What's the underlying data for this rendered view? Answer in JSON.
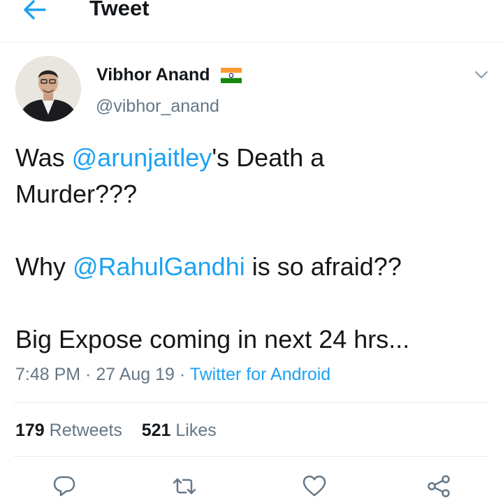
{
  "header": {
    "title": "Tweet"
  },
  "author": {
    "name": "Vibhor Anand",
    "handle": "@vibhor_anand"
  },
  "tweet": {
    "line1_pre": "Was ",
    "mention1": "@arunjaitley",
    "line1_post": "'s Death a",
    "line2": "Murder???",
    "line3_pre": "Why ",
    "mention2": "@RahulGandhi",
    "line3_post": " is so afraid??",
    "line4": "Big Expose coming in next 24 hrs..."
  },
  "meta": {
    "time": "7:48 PM",
    "date": "27 Aug 19",
    "separator": " · ",
    "source": "Twitter for Android"
  },
  "stats": {
    "retweets_count": "179",
    "retweets_label": "Retweets",
    "likes_count": "521",
    "likes_label": "Likes"
  },
  "colors": {
    "accent": "#1da1f2",
    "secondary_text": "#657786",
    "divider": "#e6ecf0"
  },
  "icons": [
    "arrow-left-icon",
    "chevron-down-icon",
    "reply-icon",
    "retweet-icon",
    "like-icon",
    "share-icon",
    "india-flag-icon"
  ]
}
